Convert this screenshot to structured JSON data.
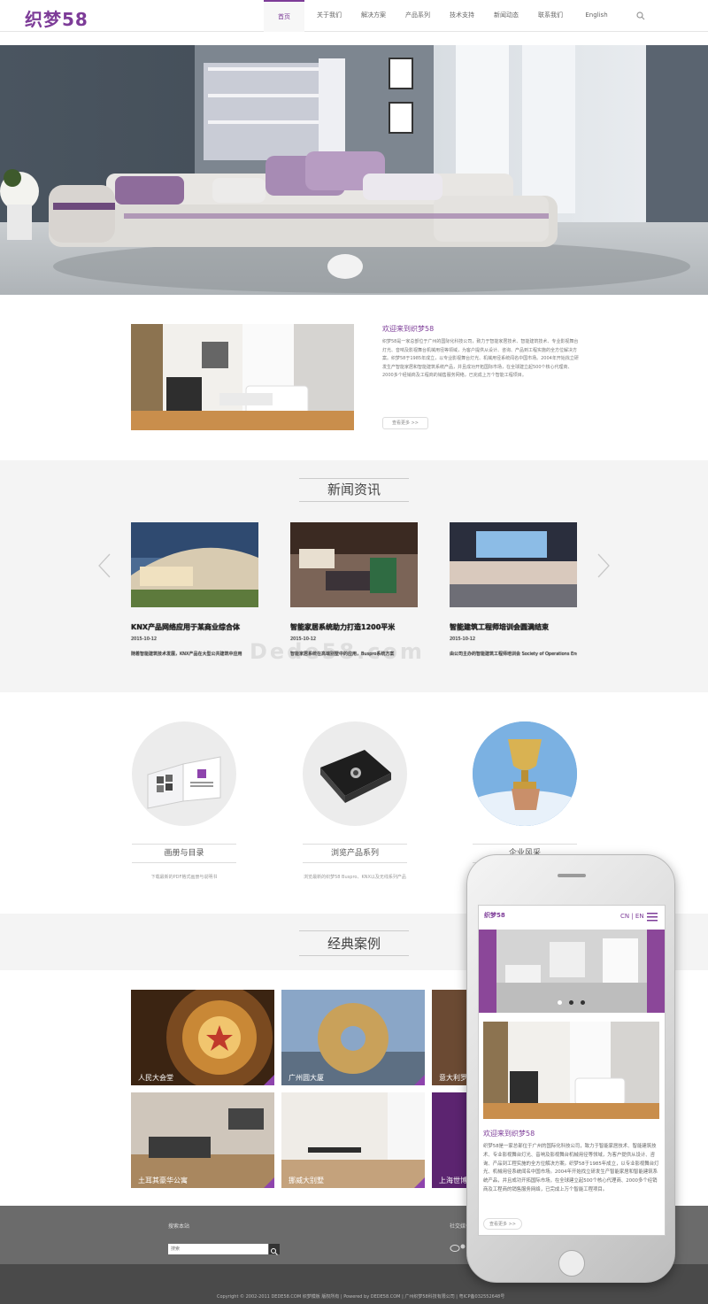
{
  "header": {
    "logo": "织梦58",
    "nav": [
      "首页",
      "关于我们",
      "解决方案",
      "产品系列",
      "技术支持",
      "新闻动态",
      "联系我们",
      "English"
    ],
    "active_index": 0,
    "search_icon": "search-icon"
  },
  "welcome": {
    "title": "欢迎来到织梦58",
    "body": "织梦58是一家总部位于广州的国际化科技公司，致力于智能家居技术、智能建筑技术、专业影视舞台灯光、音响及影视舞台机械用径等领域，为客户提供从设计、咨询、产品到工程实施的全方位解决方案。织梦58于1985年成立，以专业影视舞台灯光、机械用径系统闻名中国市场。2004年开始找立研发生产智能家居和智能建筑系统产品，并且成功开拓国际市场，在全球建立起500个核心代理商、2000多个经销商及工程商的销售服务网络，已完成上万个智能工程项目。",
    "more": "查看更多 >>"
  },
  "news": {
    "title": "新闻资讯",
    "watermark": "Dede58.com",
    "items": [
      {
        "title": "KNX产品网络应用于某商业综合体",
        "date": "2015-10-12",
        "desc": "随着智能建筑技术发展，KNX产品在大型公共建筑中应用"
      },
      {
        "title": "智能家居系统助力打造1200平米",
        "date": "2015-10-12",
        "desc": "智能家居系统在高端别墅中的应用，Buspro系统方案"
      },
      {
        "title": "智能建筑工程师培训会圆满结束",
        "date": "2015-10-12",
        "desc": "由公司主办的智能建筑工程师培训会 Society of Operations Engineers在广州举办"
      }
    ]
  },
  "features": [
    {
      "title": "画册与目录",
      "desc": "下载最新的PDF格式画册与说明书",
      "icon": "brochure-icon"
    },
    {
      "title": "浏览产品系列",
      "desc": "浏览最新的织梦58 Buspro、KNX以及无线系列产品",
      "icon": "product-box-icon"
    },
    {
      "title": "企业风采",
      "desc": "",
      "icon": "trophy-icon"
    }
  ],
  "cases": {
    "title": "经典案例",
    "items": [
      "人民大会堂",
      "广州圆大厦",
      "意大利罗马",
      "土耳其豪华公寓",
      "挪威大别墅",
      "上海世博会"
    ]
  },
  "footer": {
    "search_label": "搜索本站",
    "search_placeholder": "搜索",
    "social_label": "社交媒体",
    "copyright": "Copyright © 2002-2011 DEDE58.COM 织梦模板 版权所有 | Powered by DEDE58.COM | 广州织梦58科技有限公司 | 粤ICP备032552648号"
  },
  "mobile": {
    "logo": "织梦58",
    "lang": "CN | EN",
    "welcome_title": "欢迎来到织梦58",
    "welcome_body": "织梦58是一家总部位于广州的国际化科技公司，致力于智能家居技术、智能建筑技术、专业影视舞台灯光、音响及影视舞台机械用径等领域，为客户提供从设计、咨询、产品到工程实施的全方位解决方案。织梦58于1985年成立，以专业影视舞台灯光、机械用径系统闻名中国市场。2004年开始找立研发生产智能家居和智能建筑系统产品，并且成功开拓国际市场，在全球建立起500个核心代理商、2000多个经销商及工程商的销售服务网络，已完成上万个智能工程项目。",
    "more": "查看更多 >>"
  },
  "colors": {
    "accent": "#7d3c98",
    "footer": "#6b6b6b",
    "copyright_bar": "#4a4a4a"
  }
}
